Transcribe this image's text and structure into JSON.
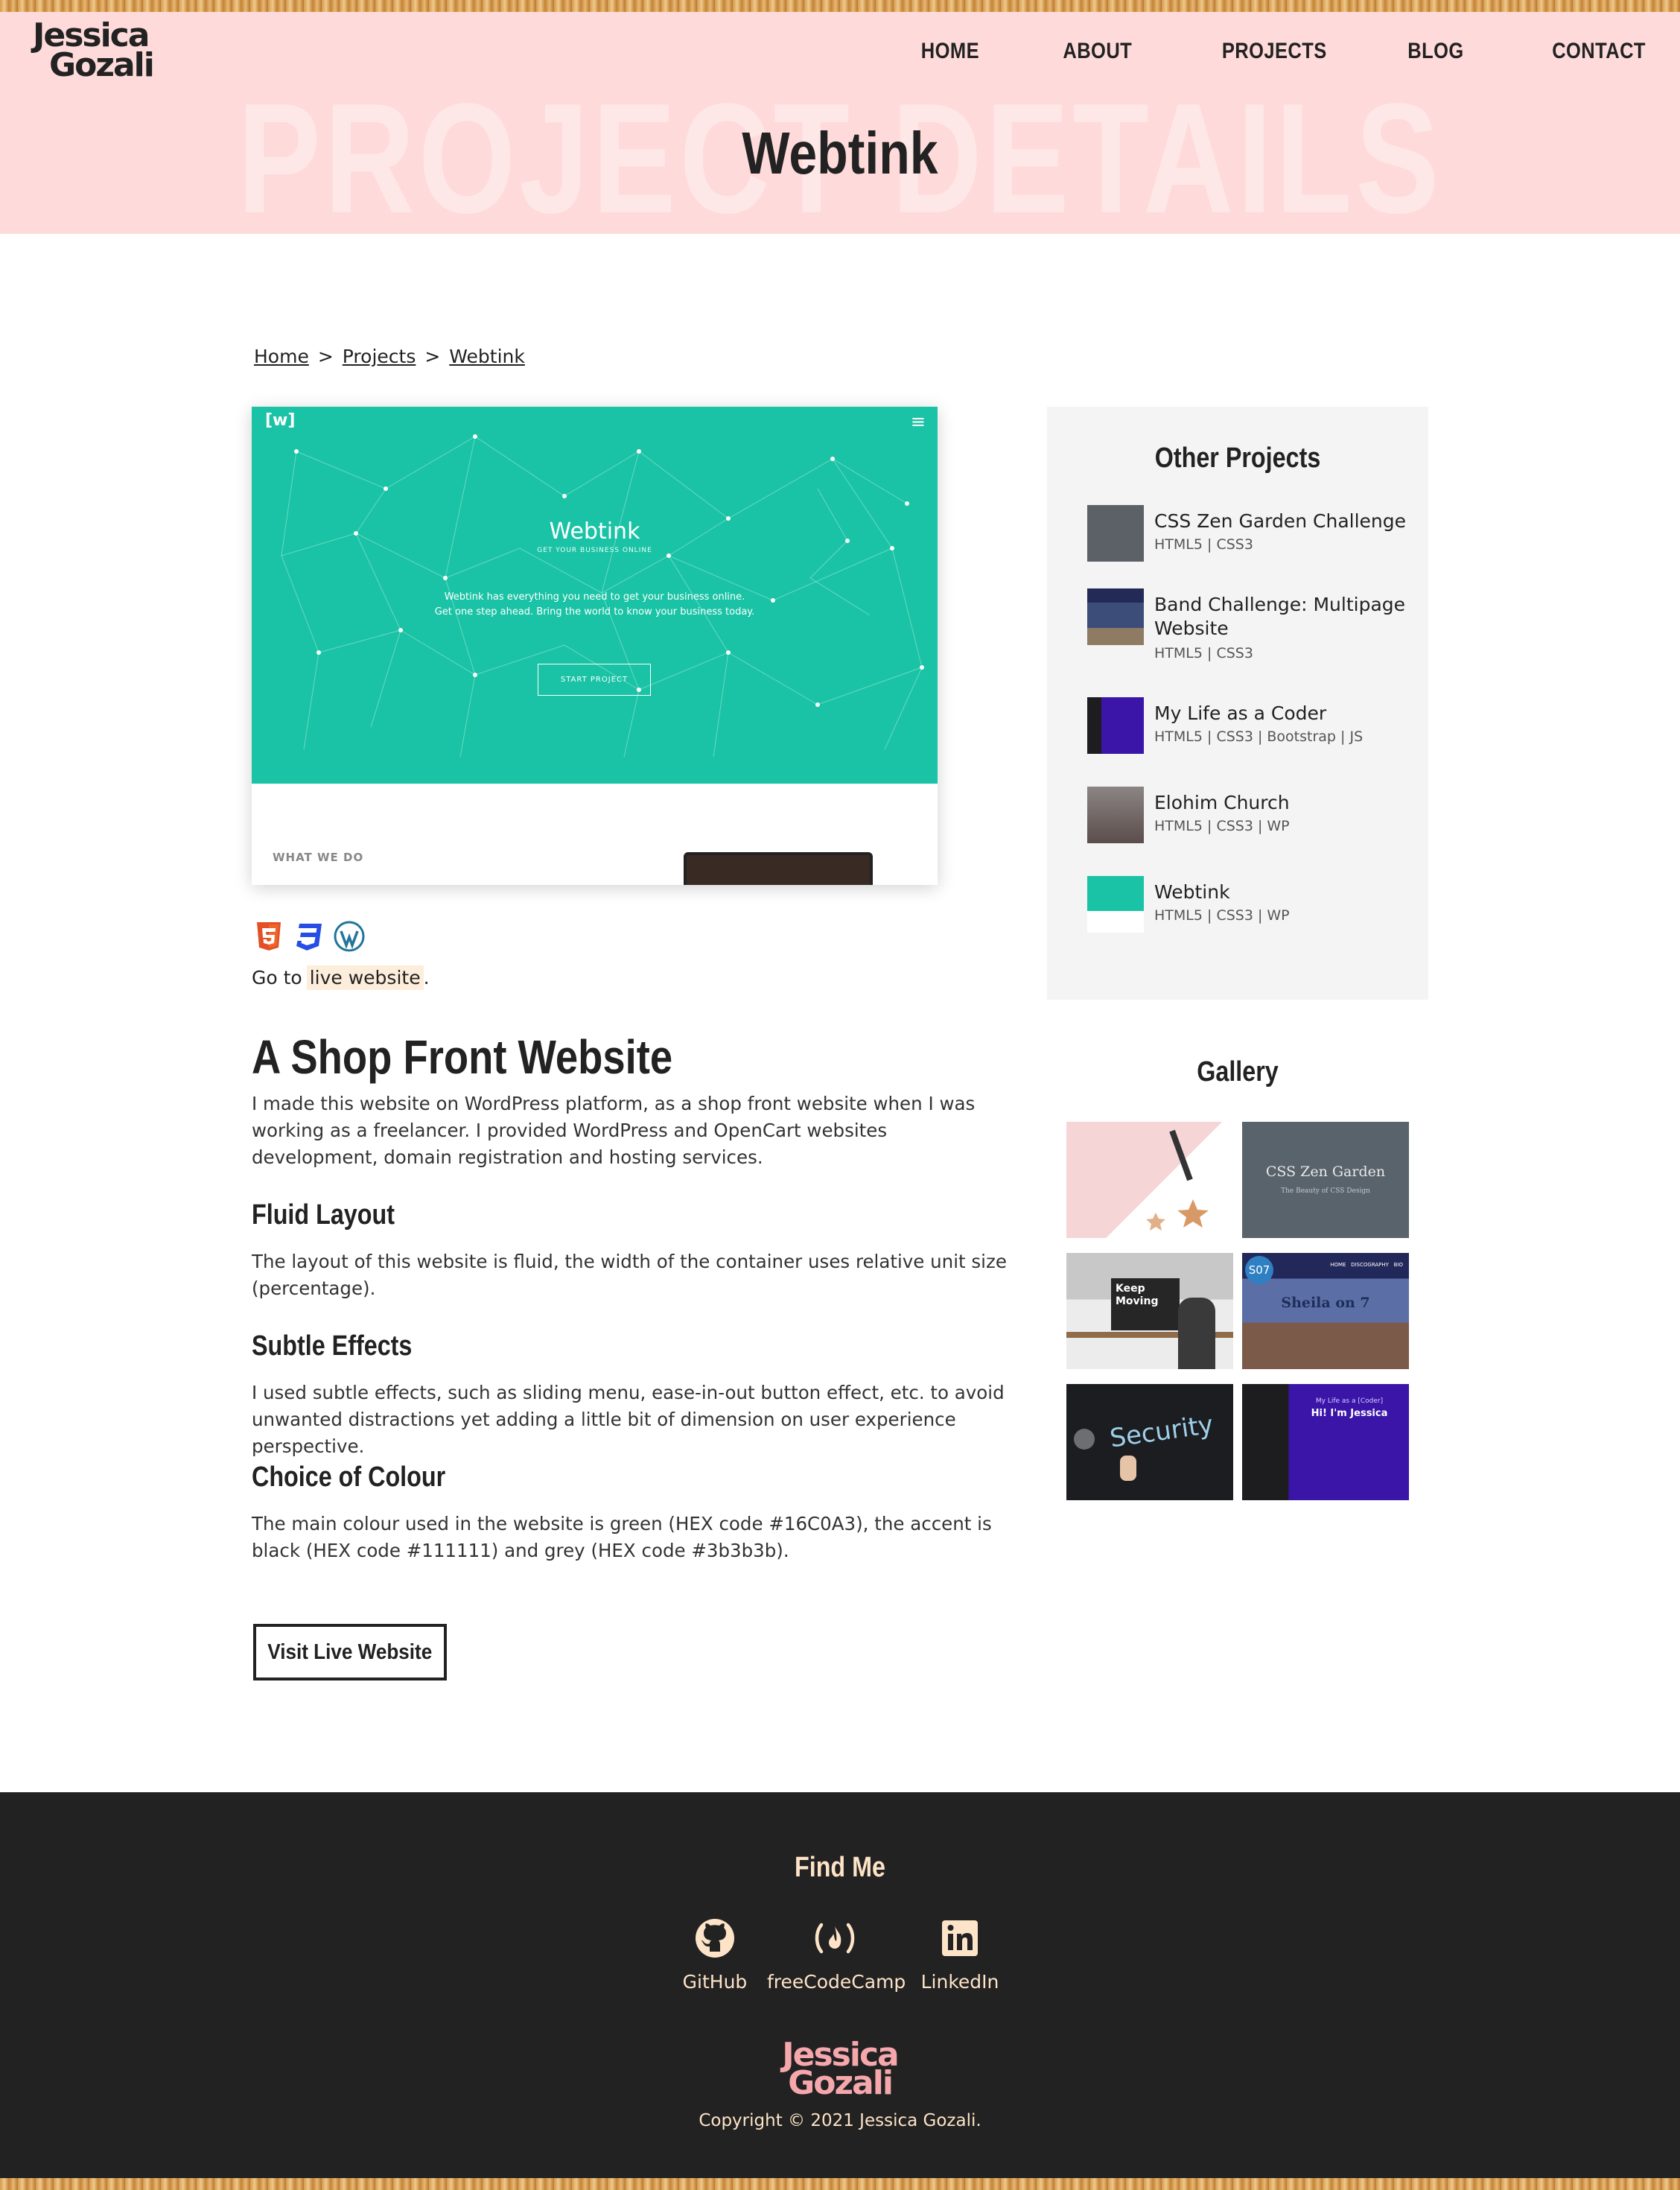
{
  "header": {
    "logo_line1": "Jessica",
    "logo_line2": "Gozali",
    "nav": [
      "HOME",
      "ABOUT",
      "PROJECTS",
      "BLOG",
      "CONTACT"
    ],
    "watermark": "PROJECT DETAILS",
    "title": "Webtink"
  },
  "breadcrumb": {
    "home": "Home",
    "sep1": ">",
    "projects": "Projects",
    "sep2": ">",
    "current": "Webtink"
  },
  "preview": {
    "logo": "[w]",
    "menu": "≡",
    "brand": "Webtink",
    "brand_sub": "GET YOUR BUSINESS ONLINE",
    "text_line1": "Webtink has everything you need to get your business online.",
    "text_line2": "Get one step ahead. Bring the world to know your business today.",
    "button": "START PROJECT",
    "section_label": "WHAT WE DO"
  },
  "tech_icons": [
    "html5-icon",
    "css3-icon",
    "wordpress-icon"
  ],
  "live": {
    "prefix": "Go to",
    "link": "live website",
    "suffix": "."
  },
  "content": {
    "title": "A Shop Front Website",
    "intro": "I made this website on WordPress platform, as a shop front website when I was working as a freelancer. I provided WordPress and OpenCart websites development, domain registration and hosting services.",
    "sections": [
      {
        "title": "Fluid Layout",
        "text": "The layout of this website is fluid, the width of the container uses relative unit size (percentage)."
      },
      {
        "title": "Subtle Effects",
        "text": "I used subtle effects, such as sliding menu, ease-in-out button effect, etc. to avoid unwanted distractions yet adding a little bit of dimension on user experience perspective."
      },
      {
        "title": "Choice of Colour",
        "text": "The main colour used in the website is green (HEX code #16C0A3), the accent is black (HEX code #111111) and grey (HEX code #3b3b3b)."
      }
    ],
    "visit_button": "Visit Live Website"
  },
  "other_projects": {
    "title": "Other Projects",
    "items": [
      {
        "name": "CSS Zen Garden Challenge",
        "tech": "HTML5 | CSS3"
      },
      {
        "name": "Band Challenge: Multipage Website",
        "tech": "HTML5 | CSS3"
      },
      {
        "name": "My Life as a Coder",
        "tech": "HTML5 | CSS3 | Bootstrap | JS"
      },
      {
        "name": "Elohim Church",
        "tech": "HTML5 | CSS3 | WP"
      },
      {
        "name": "Webtink",
        "tech": "HTML5 | CSS3 | WP"
      }
    ]
  },
  "gallery": {
    "title": "Gallery",
    "captions": {
      "zen_title": "CSS Zen Garden",
      "zen_sub": "The Beauty of CSS Design",
      "keep": "Keep Moving",
      "band_badge": "S07",
      "band_name": "Sheila on 7",
      "band_nav": "HOME   DISCOGRAPHY   BIO",
      "security": "Security",
      "coder_small": "My Life as a [Coder]",
      "coder_title": "Hi! I'm Jessica"
    }
  },
  "footer": {
    "title": "Find Me",
    "social": [
      "GitHub",
      "freeCodeCamp",
      "LinkedIn"
    ],
    "logo_line1": "Jessica",
    "logo_line2": "Gozali",
    "copyright": "Copyright © 2021 Jessica Gozali."
  },
  "colors": {
    "header_bg": "#fedbda",
    "accent_green": "#16C0A3",
    "footer_bg": "#222222",
    "footer_text": "#fde3c7",
    "live_link_bg": "#fdeedb"
  }
}
